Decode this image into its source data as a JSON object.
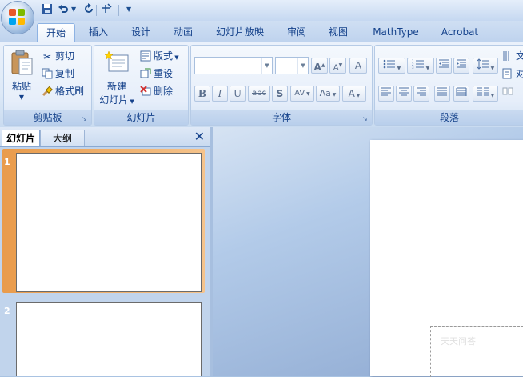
{
  "qat": {
    "save_icon": "save-icon",
    "undo_icon": "undo-icon",
    "redo_icon": "repeat-icon",
    "draw_icon": "draw-table-icon"
  },
  "tabs": [
    {
      "label": "开始",
      "active": true
    },
    {
      "label": "插入"
    },
    {
      "label": "设计"
    },
    {
      "label": "动画"
    },
    {
      "label": "幻灯片放映"
    },
    {
      "label": "审阅"
    },
    {
      "label": "视图"
    },
    {
      "label": "MathType"
    },
    {
      "label": "Acrobat"
    }
  ],
  "clipboard": {
    "paste_label": "粘贴",
    "cut_label": "剪切",
    "copy_label": "复制",
    "format_painter_label": "格式刷",
    "group_label": "剪贴板"
  },
  "slides_group": {
    "new_slide_line1": "新建",
    "new_slide_line2": "幻灯片",
    "layout_label": "版式",
    "reset_label": "重设",
    "delete_label": "删除",
    "group_label": "幻灯片"
  },
  "font_group": {
    "font_name_value": "",
    "font_size_value": "",
    "grow_label": "A",
    "shrink_label": "A",
    "clear_label": "A",
    "bold": "B",
    "italic": "I",
    "underline": "U",
    "strike": "abc",
    "shadow": "S",
    "spacing": "AV",
    "case": "Aa",
    "color": "A",
    "group_label": "字体"
  },
  "paragraph_group": {
    "group_label": "段落",
    "text_direction_label": "文",
    "align_text_label": "对"
  },
  "pane": {
    "tab_slides": "幻灯片",
    "tab_outline": "大纲",
    "slide1_num": "1",
    "slide2_num": "2"
  },
  "editor": {
    "watermark": "天天问答"
  },
  "colors": {
    "ribbon_bg": "#dde9f7",
    "accent_text": "#15428b",
    "selection": "#e99b4b",
    "workspace": "#8ea9d1"
  }
}
